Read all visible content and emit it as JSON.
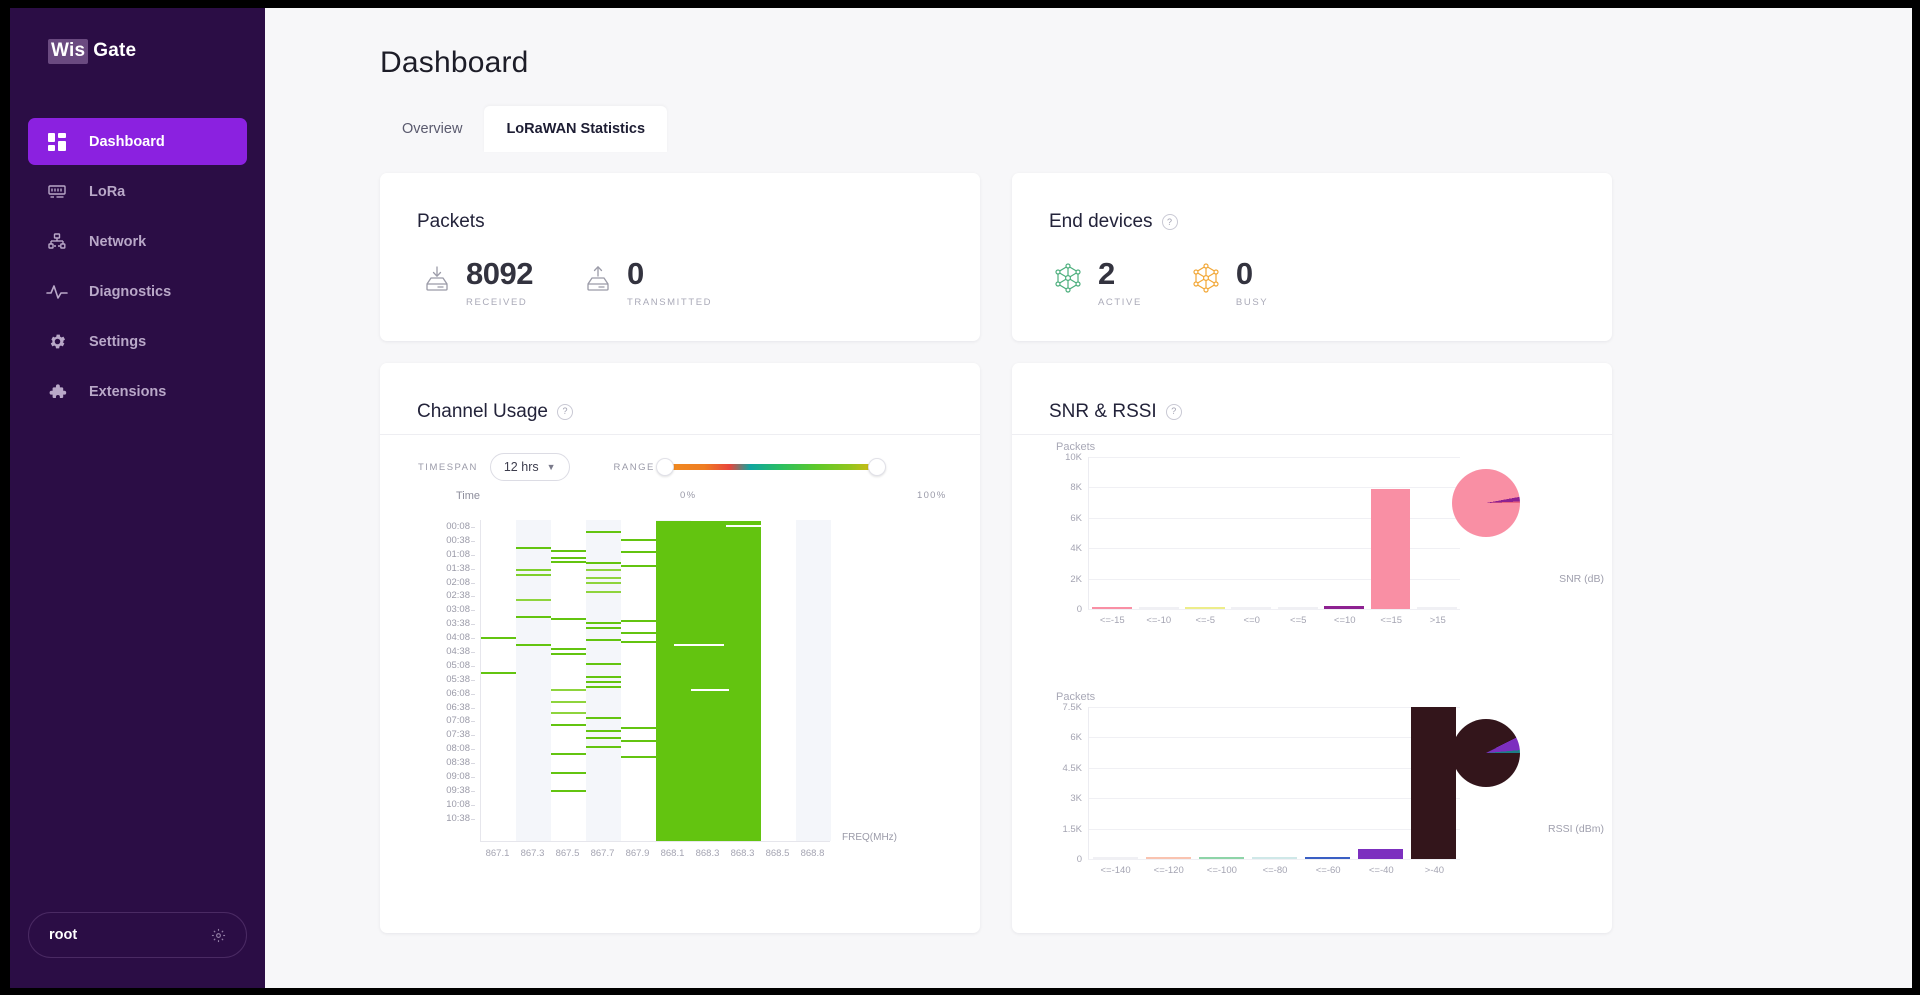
{
  "brand": {
    "part1": "Wis",
    "part2": "Gate"
  },
  "sidebar": {
    "items": [
      {
        "label": "Dashboard",
        "icon": "dashboard-icon",
        "active": true
      },
      {
        "label": "LoRa",
        "icon": "lora-icon",
        "active": false
      },
      {
        "label": "Network",
        "icon": "network-icon",
        "active": false
      },
      {
        "label": "Diagnostics",
        "icon": "diagnostics-icon",
        "active": false
      },
      {
        "label": "Settings",
        "icon": "gear-icon",
        "active": false
      },
      {
        "label": "Extensions",
        "icon": "puzzle-icon",
        "active": false
      }
    ],
    "user": {
      "name": "root",
      "icon": "gear-icon"
    }
  },
  "header": {
    "title": "Dashboard"
  },
  "tabs": [
    {
      "label": "Overview",
      "active": false
    },
    {
      "label": "LoRaWAN Statistics",
      "active": true
    }
  ],
  "packets_card": {
    "title": "Packets",
    "stats": [
      {
        "value": "8092",
        "label": "RECEIVED",
        "icon": "inbox-download-icon"
      },
      {
        "value": "0",
        "label": "TRANSMITTED",
        "icon": "outbox-upload-icon"
      }
    ]
  },
  "end_devices_card": {
    "title": "End devices",
    "help": "?",
    "stats": [
      {
        "value": "2",
        "label": "ACTIVE",
        "icon": "node-green-icon",
        "color": "#4CAF7D"
      },
      {
        "value": "0",
        "label": "BUSY",
        "icon": "node-orange-icon",
        "color": "#F2A736"
      }
    ]
  },
  "channel_usage_card": {
    "title": "Channel Usage",
    "help": "?",
    "timespan_label": "TIMESPAN",
    "timespan_value": "12 hrs",
    "range_label": "RANGE",
    "range_min": "0%",
    "range_max": "100%",
    "time_axis_label": "Time",
    "freq_axis_label": "FREQ(MHz)"
  },
  "snr_rssi_card": {
    "title": "SNR & RSSI",
    "help": "?"
  },
  "colors": {
    "sidebar_bg": "#2b0d45",
    "accent": "#8b21e0",
    "green": "#63c410",
    "pink": "#f98fa4",
    "dark_maroon": "#33151b",
    "purple": "#7c2fbf"
  },
  "chart_data": [
    {
      "type": "heatmap",
      "title": "Channel Usage",
      "xlabel": "FREQ(MHz)",
      "ylabel": "Time",
      "x_ticks": [
        "867.1",
        "867.3",
        "867.5",
        "867.7",
        "867.9",
        "868.1",
        "868.3",
        "868.3",
        "868.5",
        "868.8"
      ],
      "y_ticks": [
        "00:08",
        "00:38",
        "01:08",
        "01:38",
        "02:08",
        "02:38",
        "03:08",
        "03:38",
        "04:08",
        "04:38",
        "05:08",
        "05:38",
        "06:08",
        "06:38",
        "07:08",
        "07:38",
        "08:08",
        "08:38",
        "09:08",
        "09:38",
        "10:08",
        "10:38"
      ],
      "colorbar": {
        "min": "0%",
        "max": "100%"
      },
      "cells": [
        {
          "col": 0,
          "row_pct": 36.5,
          "usage_pct": 22,
          "color": "#63c410"
        },
        {
          "col": 0,
          "row_pct": 47.5,
          "usage_pct": 20,
          "color": "#63c410"
        },
        {
          "col": 1,
          "row_pct": 8.5,
          "usage_pct": 30,
          "color": "#63c410"
        },
        {
          "col": 1,
          "row_pct": 15.2,
          "usage_pct": 35,
          "color": "#7ecf2b"
        },
        {
          "col": 1,
          "row_pct": 16.8,
          "usage_pct": 35,
          "color": "#7ecf2b"
        },
        {
          "col": 1,
          "row_pct": 24.5,
          "usage_pct": 28,
          "color": "#8ed43c"
        },
        {
          "col": 1,
          "row_pct": 30.0,
          "usage_pct": 26,
          "color": "#63c410"
        },
        {
          "col": 1,
          "row_pct": 38.5,
          "usage_pct": 24,
          "color": "#63c410"
        },
        {
          "col": 2,
          "row_pct": 9.2,
          "usage_pct": 32,
          "color": "#63c410"
        },
        {
          "col": 2,
          "row_pct": 11.5,
          "usage_pct": 33,
          "color": "#63c410"
        },
        {
          "col": 2,
          "row_pct": 12.8,
          "usage_pct": 33,
          "color": "#63c410"
        },
        {
          "col": 2,
          "row_pct": 30.5,
          "usage_pct": 29,
          "color": "#63c410"
        },
        {
          "col": 2,
          "row_pct": 39.8,
          "usage_pct": 27,
          "color": "#63c410"
        },
        {
          "col": 2,
          "row_pct": 41.5,
          "usage_pct": 27,
          "color": "#63c410"
        },
        {
          "col": 2,
          "row_pct": 52.5,
          "usage_pct": 25,
          "color": "#8ed43c"
        },
        {
          "col": 2,
          "row_pct": 56.5,
          "usage_pct": 25,
          "color": "#8ed43c"
        },
        {
          "col": 2,
          "row_pct": 59.8,
          "usage_pct": 25,
          "color": "#8ed43c"
        },
        {
          "col": 2,
          "row_pct": 63.5,
          "usage_pct": 25,
          "color": "#63c410"
        },
        {
          "col": 2,
          "row_pct": 72.5,
          "usage_pct": 25,
          "color": "#63c410"
        },
        {
          "col": 2,
          "row_pct": 78.5,
          "usage_pct": 25,
          "color": "#63c410"
        },
        {
          "col": 2,
          "row_pct": 84.0,
          "usage_pct": 25,
          "color": "#63c410"
        },
        {
          "col": 3,
          "row_pct": 3.5,
          "usage_pct": 34,
          "color": "#63c410"
        },
        {
          "col": 3,
          "row_pct": 13.0,
          "usage_pct": 34,
          "color": "#63c410"
        },
        {
          "col": 3,
          "row_pct": 15.3,
          "usage_pct": 34,
          "color": "#8ed43c"
        },
        {
          "col": 3,
          "row_pct": 17.8,
          "usage_pct": 34,
          "color": "#8ed43c"
        },
        {
          "col": 3,
          "row_pct": 19.3,
          "usage_pct": 34,
          "color": "#8ed43c"
        },
        {
          "col": 3,
          "row_pct": 22.0,
          "usage_pct": 34,
          "color": "#8ed43c"
        },
        {
          "col": 3,
          "row_pct": 31.8,
          "usage_pct": 30,
          "color": "#63c410"
        },
        {
          "col": 3,
          "row_pct": 33.3,
          "usage_pct": 30,
          "color": "#63c410"
        },
        {
          "col": 3,
          "row_pct": 37.0,
          "usage_pct": 30,
          "color": "#63c410"
        },
        {
          "col": 3,
          "row_pct": 44.5,
          "usage_pct": 28,
          "color": "#63c410"
        },
        {
          "col": 3,
          "row_pct": 48.5,
          "usage_pct": 28,
          "color": "#63c410"
        },
        {
          "col": 3,
          "row_pct": 50.3,
          "usage_pct": 28,
          "color": "#63c410"
        },
        {
          "col": 3,
          "row_pct": 51.8,
          "usage_pct": 28,
          "color": "#63c410"
        },
        {
          "col": 3,
          "row_pct": 61.5,
          "usage_pct": 28,
          "color": "#63c410"
        },
        {
          "col": 3,
          "row_pct": 65.5,
          "usage_pct": 28,
          "color": "#63c410"
        },
        {
          "col": 3,
          "row_pct": 67.5,
          "usage_pct": 28,
          "color": "#63c410"
        },
        {
          "col": 3,
          "row_pct": 70.5,
          "usage_pct": 28,
          "color": "#63c410"
        },
        {
          "col": 4,
          "row_pct": 6.0,
          "usage_pct": 36,
          "color": "#63c410"
        },
        {
          "col": 4,
          "row_pct": 9.8,
          "usage_pct": 36,
          "color": "#63c410"
        },
        {
          "col": 4,
          "row_pct": 14.0,
          "usage_pct": 36,
          "color": "#63c410"
        },
        {
          "col": 4,
          "row_pct": 31.2,
          "usage_pct": 32,
          "color": "#63c410"
        },
        {
          "col": 4,
          "row_pct": 34.8,
          "usage_pct": 32,
          "color": "#63c410"
        },
        {
          "col": 4,
          "row_pct": 37.8,
          "usage_pct": 32,
          "color": "#63c410"
        },
        {
          "col": 4,
          "row_pct": 64.5,
          "usage_pct": 30,
          "color": "#63c410"
        },
        {
          "col": 4,
          "row_pct": 68.5,
          "usage_pct": 30,
          "color": "#63c410"
        },
        {
          "col": 4,
          "row_pct": 73.5,
          "usage_pct": 30,
          "color": "#63c410"
        }
      ],
      "solid_block": {
        "cols": [
          5,
          6,
          7
        ],
        "usage_pct": 100,
        "color": "#63c410"
      }
    },
    {
      "type": "bar",
      "title": "SNR",
      "xlabel": "SNR (dB)",
      "ylabel": "Packets",
      "categories": [
        "<=-15",
        "<=-10",
        "<=-5",
        "<=0",
        "<=5",
        "<=10",
        "<=15",
        ">15"
      ],
      "values": [
        60,
        0,
        35,
        0,
        0,
        175,
        7900,
        0
      ],
      "bar_colors": [
        "#f98fa4",
        "#f0f0f4",
        "#eded8a",
        "#f0f0f4",
        "#f0f0f4",
        "#8e2191",
        "#f98fa4",
        "#f0f0f4"
      ],
      "ylim": [
        0,
        10000
      ],
      "y_ticks": [
        "0",
        "2K",
        "4K",
        "6K",
        "8K",
        "10K"
      ],
      "grid": true
    },
    {
      "type": "pie",
      "title": "SNR distribution",
      "labels": [
        "<=15",
        "<=10",
        "<=-15"
      ],
      "values": [
        7900,
        175,
        60
      ],
      "colors": [
        "#f98fa4",
        "#8e2191",
        "#e8647f"
      ]
    },
    {
      "type": "bar",
      "title": "RSSI",
      "xlabel": "RSSI (dBm)",
      "ylabel": "Packets",
      "categories": [
        "<=-140",
        "<=-120",
        "<=-100",
        "<=-80",
        "<=-60",
        "<=-40",
        ">-40"
      ],
      "values": [
        0,
        55,
        60,
        30,
        110,
        500,
        7480
      ],
      "bar_colors": [
        "#f0f0f4",
        "#f9c3b0",
        "#8ed4a8",
        "#cfe8e8",
        "#3a5fc4",
        "#7c2fbf",
        "#33151b"
      ],
      "ylim": [
        0,
        7500
      ],
      "y_ticks": [
        "0",
        "1.5K",
        "3K",
        "4.5K",
        "6K",
        "7.5K"
      ],
      "grid": true
    },
    {
      "type": "pie",
      "title": "RSSI distribution",
      "labels": [
        ">-40",
        "<=-40",
        "<=-60"
      ],
      "values": [
        7480,
        500,
        110
      ],
      "colors": [
        "#33151b",
        "#7c2fbf",
        "#1c7f86"
      ]
    }
  ]
}
